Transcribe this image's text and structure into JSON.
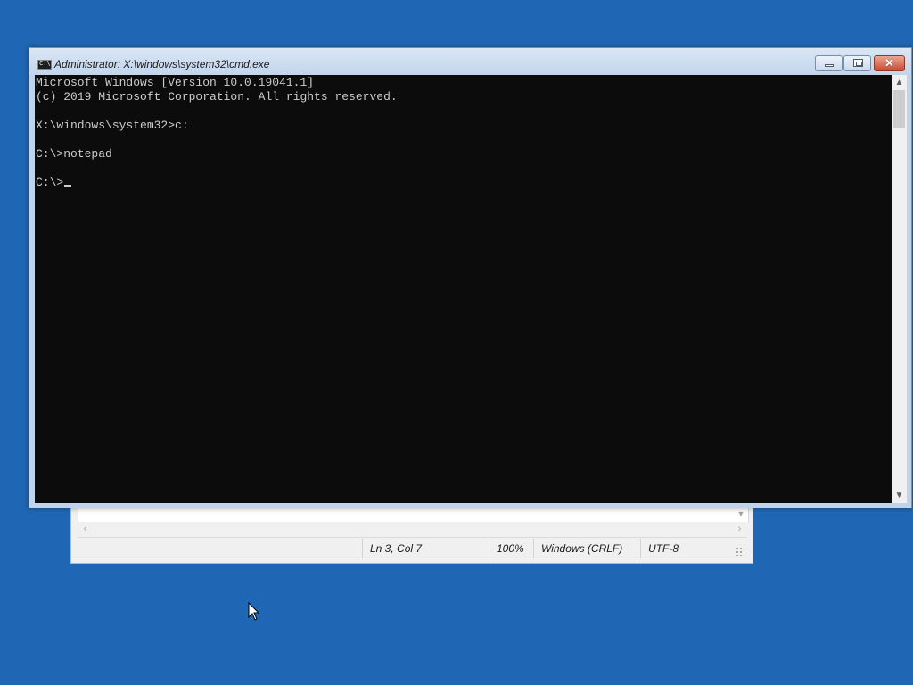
{
  "desktop": {
    "background_color": "#1f67b4"
  },
  "notepad": {
    "status": {
      "position": "Ln 3, Col 7",
      "zoom": "100%",
      "line_ending": "Windows (CRLF)",
      "encoding": "UTF-8"
    }
  },
  "cmd": {
    "title": "Administrator: X:\\windows\\system32\\cmd.exe",
    "icon": "console-icon",
    "controls": {
      "minimize": "minimize-icon",
      "maximize": "restore-icon",
      "close": "close-icon"
    },
    "close_glyph": "✕",
    "lines": [
      "Microsoft Windows [Version 10.0.19041.1]",
      "(c) 2019 Microsoft Corporation. All rights reserved.",
      "",
      "X:\\windows\\system32>c:",
      "",
      "C:\\>notepad",
      "",
      "C:\\>"
    ],
    "background_color": "#0c0c0c",
    "text_color": "#cccccc"
  }
}
